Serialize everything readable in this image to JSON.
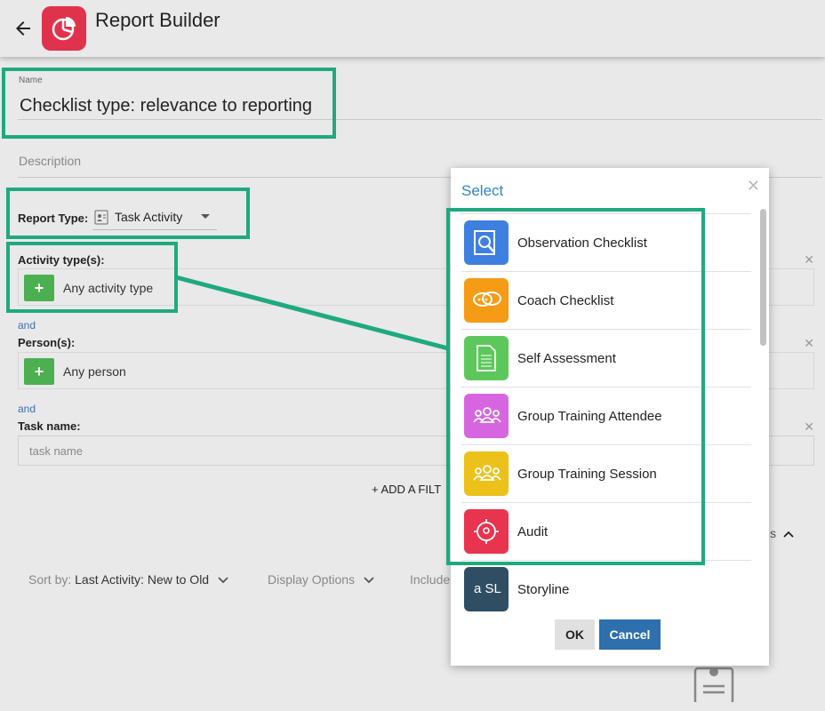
{
  "header": {
    "title": "Report Builder",
    "back_icon": "arrow-left-icon",
    "logo_icon": "pie-chart-icon",
    "logo_color": "#e0324c"
  },
  "form": {
    "name_label": "Name",
    "name_value": "Checklist type: relevance to reporting",
    "description_placeholder": "Description",
    "report_type_label": "Report Type:",
    "report_type_value": "Task Activity",
    "filters": [
      {
        "label": "Activity type(s):",
        "value": "Any activity type"
      },
      {
        "conj": "and",
        "label": "Person(s):",
        "value": "Any person"
      }
    ],
    "task_conj": "and",
    "task_label": "Task name:",
    "task_placeholder": "task name",
    "add_filter": "+ ADD A FILT"
  },
  "sortbar": {
    "sort_prefix": "Sort by:",
    "sort_value": "Last Activity: New to Old",
    "display_options": "Display Options",
    "include": "Include",
    "partial": "s"
  },
  "modal": {
    "title": "Select",
    "items": [
      {
        "label": "Observation Checklist",
        "color": "#3f7fe0",
        "icon": "magnify-document-icon"
      },
      {
        "label": "Coach Checklist",
        "color": "#f59b16",
        "icon": "chat-bubbles-icon"
      },
      {
        "label": "Self Assessment",
        "color": "#5cc85c",
        "icon": "document-icon"
      },
      {
        "label": "Group Training Attendee",
        "color": "#d765e0",
        "icon": "group-icon"
      },
      {
        "label": "Group Training Session",
        "color": "#ecc21a",
        "icon": "group-icon"
      },
      {
        "label": "Audit",
        "color": "#e8344f",
        "icon": "target-pin-icon"
      },
      {
        "label": "Storyline",
        "color": "#2f4e63",
        "icon": "storyline-logo-icon",
        "logo_text": "a SL"
      }
    ],
    "ok": "OK",
    "cancel": "Cancel"
  },
  "highlight_color": "#1fa97f"
}
